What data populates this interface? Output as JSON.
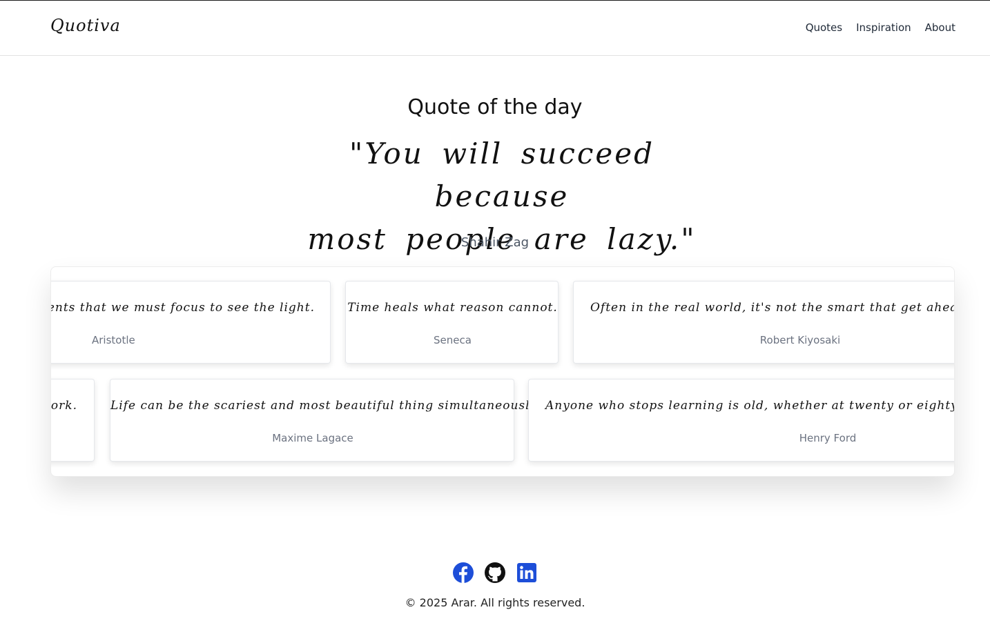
{
  "brand": {
    "logo": "Quotiva"
  },
  "nav": {
    "items": [
      "Quotes",
      "Inspiration",
      "About"
    ]
  },
  "hero": {
    "title": "Quote of the day",
    "quote_line1": "\"You will succeed because",
    "quote_line2": "most people are lazy.\"",
    "author": "Shahir Zag"
  },
  "carousel": {
    "row1": [
      {
        "quote": "moments that we must focus to see the light.",
        "author": "Aristotle"
      },
      {
        "quote": "Time heals what reason cannot.",
        "author": "Seneca"
      },
      {
        "quote": "Often in the real world, it's not the smart that get ahead, but",
        "author": "Robert Kiyosaki"
      }
    ],
    "row2": [
      {
        "quote": "work.",
        "author": ""
      },
      {
        "quote": "Life can be the scariest and most beautiful thing simultaneously.",
        "author": "Maxime Lagace"
      },
      {
        "quote": "Anyone who stops learning is old, whether at twenty or eighty. Anyone who",
        "author": "Henry Ford"
      }
    ]
  },
  "footer": {
    "icons": [
      "facebook-icon",
      "github-icon",
      "linkedin-icon"
    ],
    "copyright": "© 2025 Arar. All rights reserved.",
    "icon_color": "#1d4ed8"
  }
}
